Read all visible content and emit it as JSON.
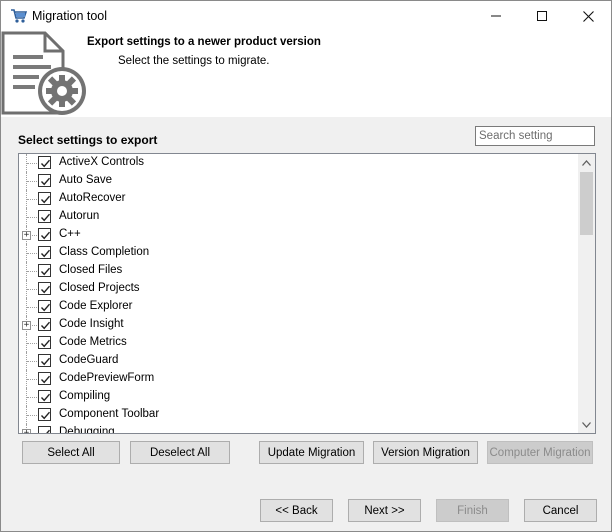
{
  "window": {
    "title": "Migration tool"
  },
  "header": {
    "title": "Export settings to a newer product version",
    "subtitle": "Select the settings to migrate."
  },
  "section_label": "Select settings to export",
  "search": {
    "placeholder": "Search setting",
    "value": ""
  },
  "tree": {
    "items": [
      {
        "label": "ActiveX Controls",
        "checked": true,
        "expandable": false
      },
      {
        "label": "Auto Save",
        "checked": true,
        "expandable": false
      },
      {
        "label": "AutoRecover",
        "checked": true,
        "expandable": false
      },
      {
        "label": "Autorun",
        "checked": true,
        "expandable": false
      },
      {
        "label": "C++",
        "checked": true,
        "expandable": true
      },
      {
        "label": "Class Completion",
        "checked": true,
        "expandable": false
      },
      {
        "label": "Closed Files",
        "checked": true,
        "expandable": false
      },
      {
        "label": "Closed Projects",
        "checked": true,
        "expandable": false
      },
      {
        "label": "Code Explorer",
        "checked": true,
        "expandable": false
      },
      {
        "label": "Code Insight",
        "checked": true,
        "expandable": true
      },
      {
        "label": "Code Metrics",
        "checked": true,
        "expandable": false
      },
      {
        "label": "CodeGuard",
        "checked": true,
        "expandable": false
      },
      {
        "label": "CodePreviewForm",
        "checked": true,
        "expandable": false
      },
      {
        "label": "Compiling",
        "checked": true,
        "expandable": false
      },
      {
        "label": "Component Toolbar",
        "checked": true,
        "expandable": false
      },
      {
        "label": "Debugging",
        "checked": true,
        "expandable": true
      }
    ]
  },
  "buttons": {
    "select_all": "Select All",
    "deselect_all": "Deselect All",
    "update_migration": "Update Migration",
    "version_migration": "Version Migration",
    "computer_migration": "Computer Migration",
    "back": "<< Back",
    "next": "Next >>",
    "finish": "Finish",
    "cancel": "Cancel"
  }
}
